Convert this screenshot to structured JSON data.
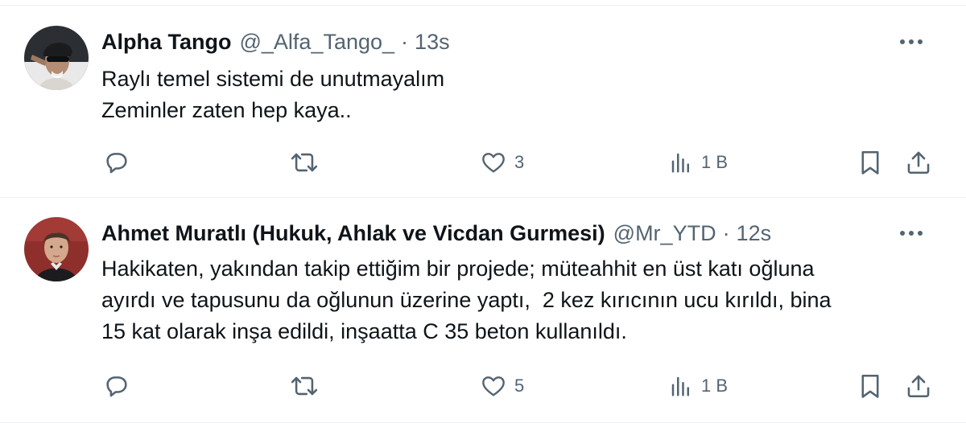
{
  "tweets": [
    {
      "display_name": "Alpha Tango",
      "handle": "@_Alfa_Tango_",
      "separator": "·",
      "time": "13s",
      "text_lines": [
        "Raylı temel sistemi de unutmayalım",
        "Zeminler zaten hep kaya.."
      ],
      "replies": "",
      "reposts": "",
      "likes": "3",
      "views": "1 B",
      "icons": {
        "more": "more-horizontal-icon",
        "reply": "reply-icon",
        "repost": "repost-icon",
        "like": "heart-icon",
        "views": "views-chart-icon",
        "bookmark": "bookmark-icon",
        "share": "share-icon"
      }
    },
    {
      "display_name": "Ahmet Muratlı (Hukuk, Ahlak ve Vicdan Gurmesi)",
      "handle": "@Mr_YTD",
      "separator": "·",
      "time": "12s",
      "text_lines": [
        "Hakikaten, yakından takip ettiğim bir projede; müteahhit en üst katı oğluna",
        "ayırdı ve tapusunu da oğlunun üzerine yaptı,  2 kez kırıcının ucu kırıldı, bina",
        "15 kat olarak inşa edildi, inşaatta C 35 beton kullanıldı."
      ],
      "replies": "",
      "reposts": "",
      "likes": "5",
      "views": "1 B",
      "icons": {
        "more": "more-horizontal-icon",
        "reply": "reply-icon",
        "repost": "repost-icon",
        "like": "heart-icon",
        "views": "views-chart-icon",
        "bookmark": "bookmark-icon",
        "share": "share-icon"
      }
    }
  ],
  "colors": {
    "text_primary": "#0f1419",
    "text_secondary": "#536471",
    "divider": "#eff3f4"
  }
}
